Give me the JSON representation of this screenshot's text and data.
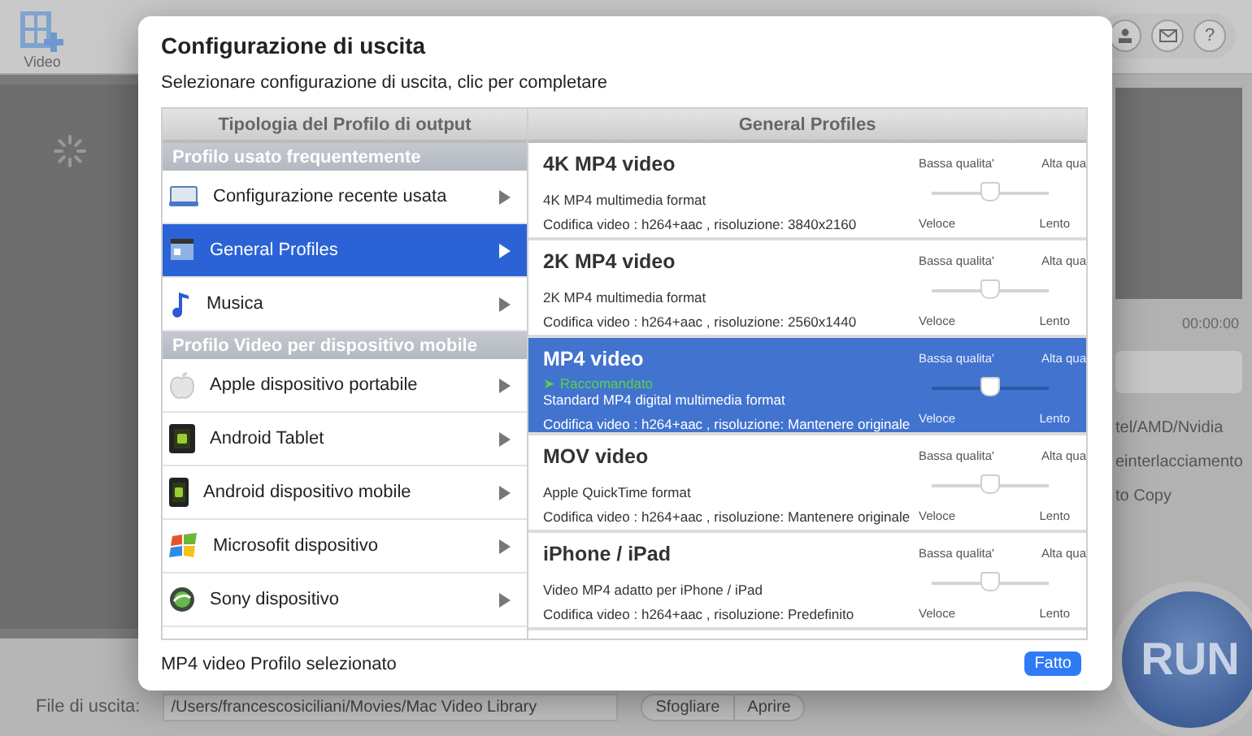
{
  "app": {
    "toolbar": [
      {
        "label": "Video"
      }
    ],
    "help": "?",
    "time": "00:00:00",
    "options": [
      "tel/AMD/Nvidia",
      "einterlacciamento",
      "to Copy"
    ],
    "output_label": "File di uscita:",
    "output_path": "/Users/francescosiciliani/Movies/Mac Video Library",
    "buttons": [
      "Sfogliare",
      "Aprire"
    ],
    "run": "RUN"
  },
  "dialog": {
    "title": "Configurazione di uscita",
    "subtitle": "Selezionare configurazione di uscita, clic per completare",
    "left_header": "Tipologia del Profilo di output",
    "right_header": "General Profiles",
    "categories": [
      {
        "kind": "header",
        "label": "Profilo usato frequentemente"
      },
      {
        "kind": "item",
        "label": "Configurazione recente usata",
        "selected": false
      },
      {
        "kind": "item",
        "label": "General Profiles",
        "selected": true
      },
      {
        "kind": "item",
        "label": "Musica",
        "selected": false
      },
      {
        "kind": "header",
        "label": "Profilo Video per dispositivo mobile"
      },
      {
        "kind": "item",
        "label": "Apple dispositivo portabile",
        "selected": false
      },
      {
        "kind": "item",
        "label": "Android Tablet",
        "selected": false
      },
      {
        "kind": "item",
        "label": "Android dispositivo mobile",
        "selected": false
      },
      {
        "kind": "item",
        "label": "Microsofit dispositivo",
        "selected": false
      },
      {
        "kind": "item",
        "label": "Sony dispositivo",
        "selected": false
      }
    ],
    "profiles": [
      {
        "title": "4K MP4 video",
        "description": "4K MP4 multimedia format",
        "encoding": "Codifica video : h264+aac , risoluzione: 3840x2160",
        "low": "Bassa qualita'",
        "high": "Alta qua",
        "fast": "Veloce",
        "slow": "Lento",
        "level": 0.5,
        "selected": false
      },
      {
        "title": "2K MP4 video",
        "description": "2K MP4 multimedia format",
        "encoding": "Codifica video : h264+aac , risoluzione: 2560x1440",
        "low": "Bassa qualita'",
        "high": "Alta qua",
        "fast": "Veloce",
        "slow": "Lento",
        "level": 0.5,
        "selected": false
      },
      {
        "title": "MP4 video",
        "badge": "➤  Raccomandato",
        "description": "Standard MP4 digital multimedia format",
        "encoding": "Codifica video : h264+aac , risoluzione: Mantenere originale",
        "low": "Bassa qualita'",
        "high": "Alta qua",
        "fast": "Veloce",
        "slow": "Lento",
        "level": 0.5,
        "selected": true
      },
      {
        "title": "MOV video",
        "description": "Apple QuickTime format",
        "encoding": "Codifica video : h264+aac , risoluzione: Mantenere originale",
        "low": "Bassa qualita'",
        "high": "Alta qua",
        "fast": "Veloce",
        "slow": "Lento",
        "level": 0.5,
        "selected": false
      },
      {
        "title": "iPhone / iPad",
        "description": "Video MP4 adatto per iPhone / iPad",
        "encoding": "Codifica video : h264+aac , risoluzione: Predefinito",
        "low": "Bassa qualita'",
        "high": "Alta qua",
        "fast": "Veloce",
        "slow": "Lento",
        "level": 0.5,
        "selected": false
      }
    ],
    "status": "MP4 video Profilo selezionato",
    "done": "Fatto"
  }
}
